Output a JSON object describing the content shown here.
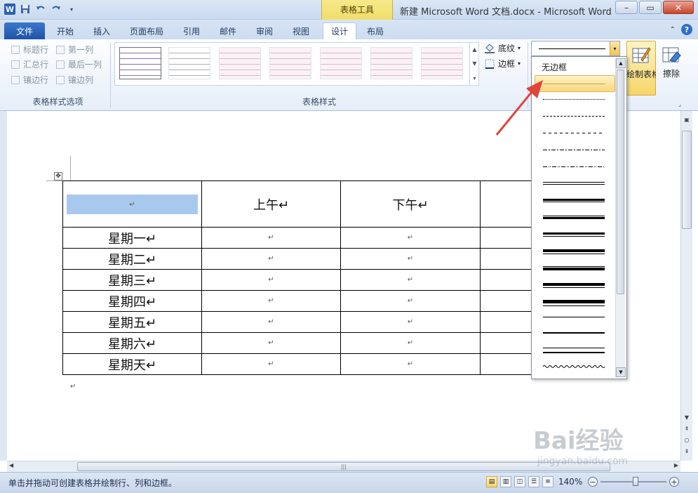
{
  "window": {
    "title": "新建 Microsoft Word 文档.docx - Microsoft Word",
    "context_group": "表格工具"
  },
  "tabs": [
    {
      "label": "文件"
    },
    {
      "label": "开始"
    },
    {
      "label": "插入"
    },
    {
      "label": "页面布局"
    },
    {
      "label": "引用"
    },
    {
      "label": "邮件"
    },
    {
      "label": "审阅"
    },
    {
      "label": "视图"
    },
    {
      "label": "设计",
      "active": true
    },
    {
      "label": "布局"
    }
  ],
  "ribbon": {
    "style_options": {
      "label": "表格样式选项",
      "items": [
        "标题行",
        "第一列",
        "汇总行",
        "最后一列",
        "镶边行",
        "镶边列"
      ]
    },
    "table_styles": {
      "label": "表格样式"
    },
    "shading": "底纹",
    "borders": "边框",
    "draw_table": "绘制表格",
    "eraser": "擦除"
  },
  "dropdown": {
    "no_border": "无边框"
  },
  "table": {
    "header": [
      "↵",
      "上午↵",
      "下午↵",
      ""
    ],
    "rows": [
      {
        "day": "星期一↵",
        "cells": [
          "↵",
          "↵",
          ""
        ]
      },
      {
        "day": "星期二↵",
        "cells": [
          "↵",
          "↵",
          ""
        ]
      },
      {
        "day": "星期三↵",
        "cells": [
          "↵",
          "↵",
          ""
        ]
      },
      {
        "day": "星期四↵",
        "cells": [
          "↵",
          "↵",
          ""
        ]
      },
      {
        "day": "星期五↵",
        "cells": [
          "↵",
          "↵",
          ""
        ]
      },
      {
        "day": "星期六↵",
        "cells": [
          "↵",
          "↵",
          ""
        ]
      },
      {
        "day": "星期天↵",
        "cells": [
          "↵",
          "↵",
          ""
        ]
      }
    ],
    "end_mark": "↵"
  },
  "statusbar": {
    "hint": "单击并拖动可创建表格并绘制行、列和边框。",
    "zoom": "140%",
    "zoom_out": "−",
    "zoom_in": "+"
  },
  "watermark": {
    "brand": "Bai经验",
    "url": "jingyan.baidu.com"
  },
  "colors": {
    "accent": "#2b5fb4",
    "context_tab": "#e7d24a",
    "selection": "#a9c8ee",
    "highlight": "#f9d77a",
    "arrow": "#e0453a"
  }
}
